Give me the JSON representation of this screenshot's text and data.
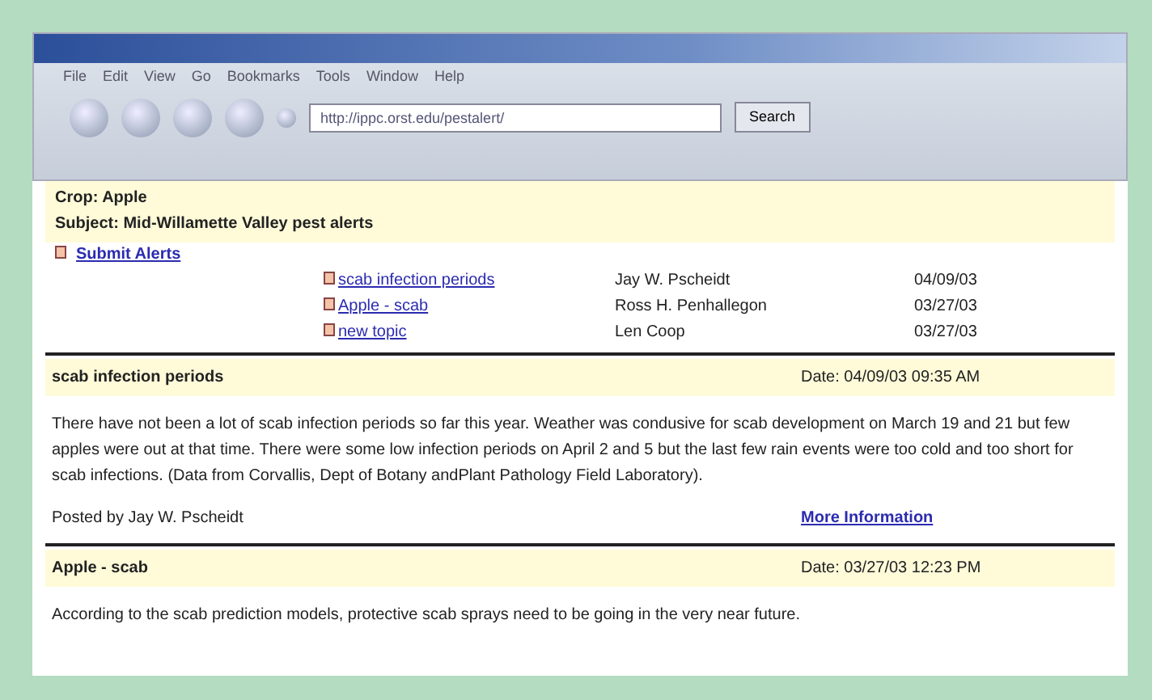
{
  "browser": {
    "menu": [
      "File",
      "Edit",
      "View",
      "Go",
      "Bookmarks",
      "Tools",
      "Window",
      "Help"
    ],
    "url": "http://ippc.orst.edu/pestalert/",
    "search_button": "Search"
  },
  "header": {
    "crop": "Crop:  Apple",
    "subject": "Subject: Mid-Willamette Valley pest alerts",
    "submit_link": "Submit Alerts"
  },
  "topics": [
    {
      "title": "scab infection periods",
      "author": "Jay W. Pscheidt",
      "date": "04/09/03"
    },
    {
      "title": "Apple - scab",
      "author": "Ross H. Penhallegon",
      "date": "03/27/03"
    },
    {
      "title": "new topic",
      "author": "Len Coop",
      "date": "03/27/03"
    }
  ],
  "posts": [
    {
      "title": "scab infection periods",
      "date": "Date: 04/09/03  09:35 AM",
      "body": "There have not been a  lot of scab infection periods so far this year.  Weather was condusive for scab development on March 19 and 21 but few apples were out at that time.  There were some low infection periods on April 2 and 5 but the last few rain events were too cold and too short for scab infections.  (Data from Corvallis, Dept of Botany andPlant Pathology Field Laboratory).",
      "posted_by": "Posted by Jay W. Pscheidt",
      "more_link": "More Information"
    },
    {
      "title": "Apple - scab",
      "date": "Date: 03/27/03  12:23 PM",
      "body": "According to the scab prediction models, protective scab sprays need to be going in the very near future."
    }
  ]
}
